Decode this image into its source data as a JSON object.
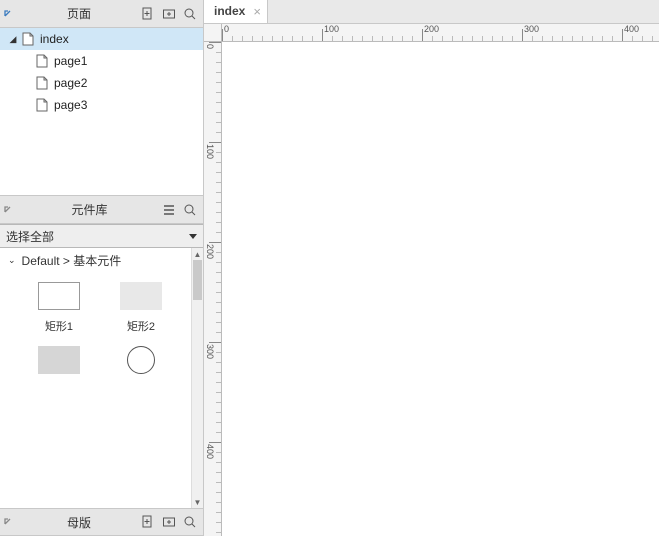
{
  "panels": {
    "pages": {
      "title": "页面",
      "tree": [
        {
          "label": "index",
          "expanded": true,
          "selected": true
        },
        {
          "label": "page1"
        },
        {
          "label": "page2"
        },
        {
          "label": "page3"
        }
      ]
    },
    "library": {
      "title": "元件库",
      "select_label": "选择全部",
      "category": "Default > 基本元件",
      "items": {
        "rect1": "矩形1",
        "rect2": "矩形2"
      }
    },
    "masters": {
      "title": "母版"
    }
  },
  "tabs": {
    "active_label": "index"
  },
  "ruler": {
    "major": 100,
    "minor": 10,
    "labels_h": [
      "0",
      "100",
      "200",
      "300",
      "400"
    ],
    "labels_v": [
      "0",
      "100",
      "200",
      "300",
      "400"
    ]
  }
}
